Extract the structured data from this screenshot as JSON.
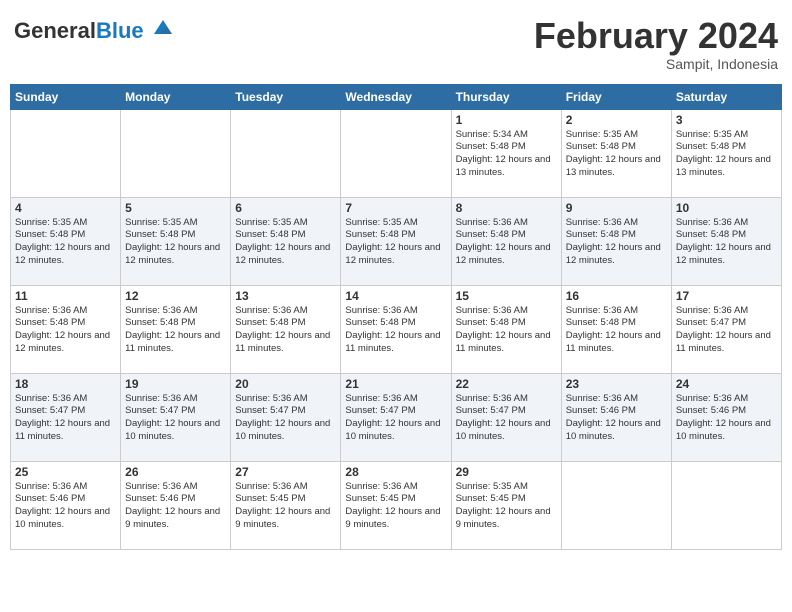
{
  "header": {
    "logo_general": "General",
    "logo_blue": "Blue",
    "month_title": "February 2024",
    "subtitle": "Sampit, Indonesia"
  },
  "weekdays": [
    "Sunday",
    "Monday",
    "Tuesday",
    "Wednesday",
    "Thursday",
    "Friday",
    "Saturday"
  ],
  "rows": [
    [
      {
        "day": "",
        "info": ""
      },
      {
        "day": "",
        "info": ""
      },
      {
        "day": "",
        "info": ""
      },
      {
        "day": "",
        "info": ""
      },
      {
        "day": "1",
        "info": "Sunrise: 5:34 AM\nSunset: 5:48 PM\nDaylight: 12 hours\nand 13 minutes."
      },
      {
        "day": "2",
        "info": "Sunrise: 5:35 AM\nSunset: 5:48 PM\nDaylight: 12 hours\nand 13 minutes."
      },
      {
        "day": "3",
        "info": "Sunrise: 5:35 AM\nSunset: 5:48 PM\nDaylight: 12 hours\nand 13 minutes."
      }
    ],
    [
      {
        "day": "4",
        "info": "Sunrise: 5:35 AM\nSunset: 5:48 PM\nDaylight: 12 hours\nand 12 minutes."
      },
      {
        "day": "5",
        "info": "Sunrise: 5:35 AM\nSunset: 5:48 PM\nDaylight: 12 hours\nand 12 minutes."
      },
      {
        "day": "6",
        "info": "Sunrise: 5:35 AM\nSunset: 5:48 PM\nDaylight: 12 hours\nand 12 minutes."
      },
      {
        "day": "7",
        "info": "Sunrise: 5:35 AM\nSunset: 5:48 PM\nDaylight: 12 hours\nand 12 minutes."
      },
      {
        "day": "8",
        "info": "Sunrise: 5:36 AM\nSunset: 5:48 PM\nDaylight: 12 hours\nand 12 minutes."
      },
      {
        "day": "9",
        "info": "Sunrise: 5:36 AM\nSunset: 5:48 PM\nDaylight: 12 hours\nand 12 minutes."
      },
      {
        "day": "10",
        "info": "Sunrise: 5:36 AM\nSunset: 5:48 PM\nDaylight: 12 hours\nand 12 minutes."
      }
    ],
    [
      {
        "day": "11",
        "info": "Sunrise: 5:36 AM\nSunset: 5:48 PM\nDaylight: 12 hours\nand 12 minutes."
      },
      {
        "day": "12",
        "info": "Sunrise: 5:36 AM\nSunset: 5:48 PM\nDaylight: 12 hours\nand 11 minutes."
      },
      {
        "day": "13",
        "info": "Sunrise: 5:36 AM\nSunset: 5:48 PM\nDaylight: 12 hours\nand 11 minutes."
      },
      {
        "day": "14",
        "info": "Sunrise: 5:36 AM\nSunset: 5:48 PM\nDaylight: 12 hours\nand 11 minutes."
      },
      {
        "day": "15",
        "info": "Sunrise: 5:36 AM\nSunset: 5:48 PM\nDaylight: 12 hours\nand 11 minutes."
      },
      {
        "day": "16",
        "info": "Sunrise: 5:36 AM\nSunset: 5:48 PM\nDaylight: 12 hours\nand 11 minutes."
      },
      {
        "day": "17",
        "info": "Sunrise: 5:36 AM\nSunset: 5:47 PM\nDaylight: 12 hours\nand 11 minutes."
      }
    ],
    [
      {
        "day": "18",
        "info": "Sunrise: 5:36 AM\nSunset: 5:47 PM\nDaylight: 12 hours\nand 11 minutes."
      },
      {
        "day": "19",
        "info": "Sunrise: 5:36 AM\nSunset: 5:47 PM\nDaylight: 12 hours\nand 10 minutes."
      },
      {
        "day": "20",
        "info": "Sunrise: 5:36 AM\nSunset: 5:47 PM\nDaylight: 12 hours\nand 10 minutes."
      },
      {
        "day": "21",
        "info": "Sunrise: 5:36 AM\nSunset: 5:47 PM\nDaylight: 12 hours\nand 10 minutes."
      },
      {
        "day": "22",
        "info": "Sunrise: 5:36 AM\nSunset: 5:47 PM\nDaylight: 12 hours\nand 10 minutes."
      },
      {
        "day": "23",
        "info": "Sunrise: 5:36 AM\nSunset: 5:46 PM\nDaylight: 12 hours\nand 10 minutes."
      },
      {
        "day": "24",
        "info": "Sunrise: 5:36 AM\nSunset: 5:46 PM\nDaylight: 12 hours\nand 10 minutes."
      }
    ],
    [
      {
        "day": "25",
        "info": "Sunrise: 5:36 AM\nSunset: 5:46 PM\nDaylight: 12 hours\nand 10 minutes."
      },
      {
        "day": "26",
        "info": "Sunrise: 5:36 AM\nSunset: 5:46 PM\nDaylight: 12 hours\nand 9 minutes."
      },
      {
        "day": "27",
        "info": "Sunrise: 5:36 AM\nSunset: 5:45 PM\nDaylight: 12 hours\nand 9 minutes."
      },
      {
        "day": "28",
        "info": "Sunrise: 5:36 AM\nSunset: 5:45 PM\nDaylight: 12 hours\nand 9 minutes."
      },
      {
        "day": "29",
        "info": "Sunrise: 5:35 AM\nSunset: 5:45 PM\nDaylight: 12 hours\nand 9 minutes."
      },
      {
        "day": "",
        "info": ""
      },
      {
        "day": "",
        "info": ""
      }
    ]
  ]
}
